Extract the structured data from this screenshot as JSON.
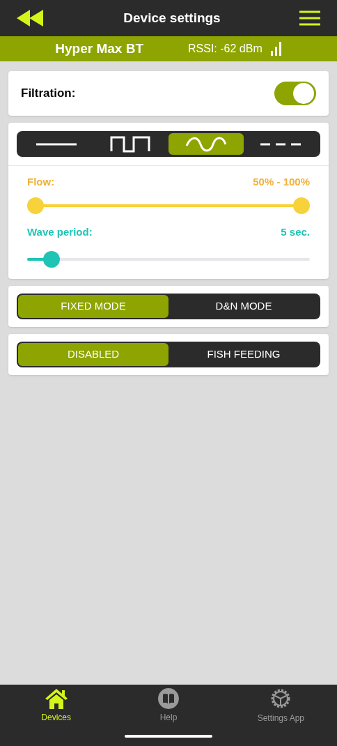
{
  "header": {
    "title": "Device settings"
  },
  "device": {
    "name": "Hyper Max BT",
    "rssi": "RSSI: -62 dBm"
  },
  "filtration": {
    "label": "Filtration:",
    "on": true
  },
  "wave_modes": [
    {
      "kind": "constant",
      "selected": false
    },
    {
      "kind": "pulse",
      "selected": false
    },
    {
      "kind": "sine",
      "selected": true
    },
    {
      "kind": "dashed",
      "selected": false
    }
  ],
  "flow": {
    "label": "Flow:",
    "reading": "50% - 100%",
    "thumbs": [
      {
        "level": 0
      },
      {
        "level": 1
      }
    ]
  },
  "wave_period": {
    "label": "Wave period:",
    "reading": "5 sec.",
    "level": 0.06
  },
  "mode_toggles": [
    [
      {
        "label": "FIXED MODE",
        "selected": true
      },
      {
        "label": "D&N MODE",
        "selected": false
      }
    ],
    [
      {
        "label": "DISABLED",
        "selected": true
      },
      {
        "label": "FISH FEEDING",
        "selected": false
      }
    ]
  ],
  "nav": [
    {
      "kind": "home",
      "label": "Devices",
      "selected": true
    },
    {
      "kind": "help",
      "label": "Help",
      "selected": false
    },
    {
      "kind": "gear",
      "label": "Settings App",
      "selected": false
    }
  ]
}
